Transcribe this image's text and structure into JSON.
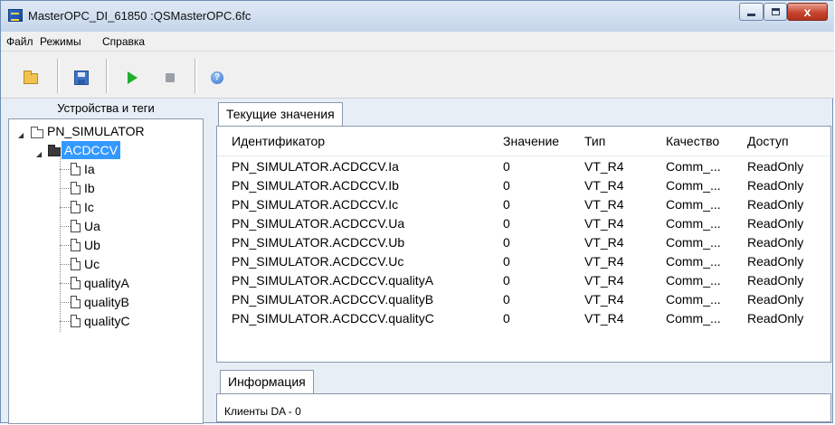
{
  "window": {
    "title": "MasterOPC_DI_61850 :QSMasterOPC.6fc",
    "minimize_glyph": "",
    "maximize_glyph": "",
    "close_glyph": "x"
  },
  "menu": {
    "items": [
      {
        "label": "Файл"
      },
      {
        "label": "Режимы"
      },
      {
        "label": "Справка"
      }
    ]
  },
  "toolbar": {
    "buttons": [
      {
        "icon": "open-folder-icon"
      },
      {
        "icon": "save-icon"
      },
      {
        "icon": "play-icon",
        "color": "#1fae2d"
      },
      {
        "icon": "stop-icon"
      },
      {
        "icon": "help-icon"
      }
    ]
  },
  "tree": {
    "header": "Устройства и теги",
    "root": "PN_SIMULATOR",
    "device": "ACDCCV",
    "tags": [
      "Ia",
      "Ib",
      "Ic",
      "Ua",
      "Ub",
      "Uc",
      "qualityA",
      "qualityB",
      "qualityC"
    ],
    "selection_color": "#3399ff"
  },
  "values_tab": {
    "label": "Текущие значения",
    "columns": [
      "Идентификатор",
      "Значение",
      "Тип",
      "Качество",
      "Доступ"
    ],
    "rows": [
      [
        "PN_SIMULATOR.ACDCCV.Ia",
        "0",
        "VT_R4",
        "Comm_...",
        "ReadOnly"
      ],
      [
        "PN_SIMULATOR.ACDCCV.Ib",
        "0",
        "VT_R4",
        "Comm_...",
        "ReadOnly"
      ],
      [
        "PN_SIMULATOR.ACDCCV.Ic",
        "0",
        "VT_R4",
        "Comm_...",
        "ReadOnly"
      ],
      [
        "PN_SIMULATOR.ACDCCV.Ua",
        "0",
        "VT_R4",
        "Comm_...",
        "ReadOnly"
      ],
      [
        "PN_SIMULATOR.ACDCCV.Ub",
        "0",
        "VT_R4",
        "Comm_...",
        "ReadOnly"
      ],
      [
        "PN_SIMULATOR.ACDCCV.Uc",
        "0",
        "VT_R4",
        "Comm_...",
        "ReadOnly"
      ],
      [
        "PN_SIMULATOR.ACDCCV.qualityA",
        "0",
        "VT_R4",
        "Comm_...",
        "ReadOnly"
      ],
      [
        "PN_SIMULATOR.ACDCCV.qualityB",
        "0",
        "VT_R4",
        "Comm_...",
        "ReadOnly"
      ],
      [
        "PN_SIMULATOR.ACDCCV.qualityC",
        "0",
        "VT_R4",
        "Comm_...",
        "ReadOnly"
      ]
    ]
  },
  "info_tab": {
    "label": "Информация",
    "text": "Клиенты DA - 0"
  }
}
